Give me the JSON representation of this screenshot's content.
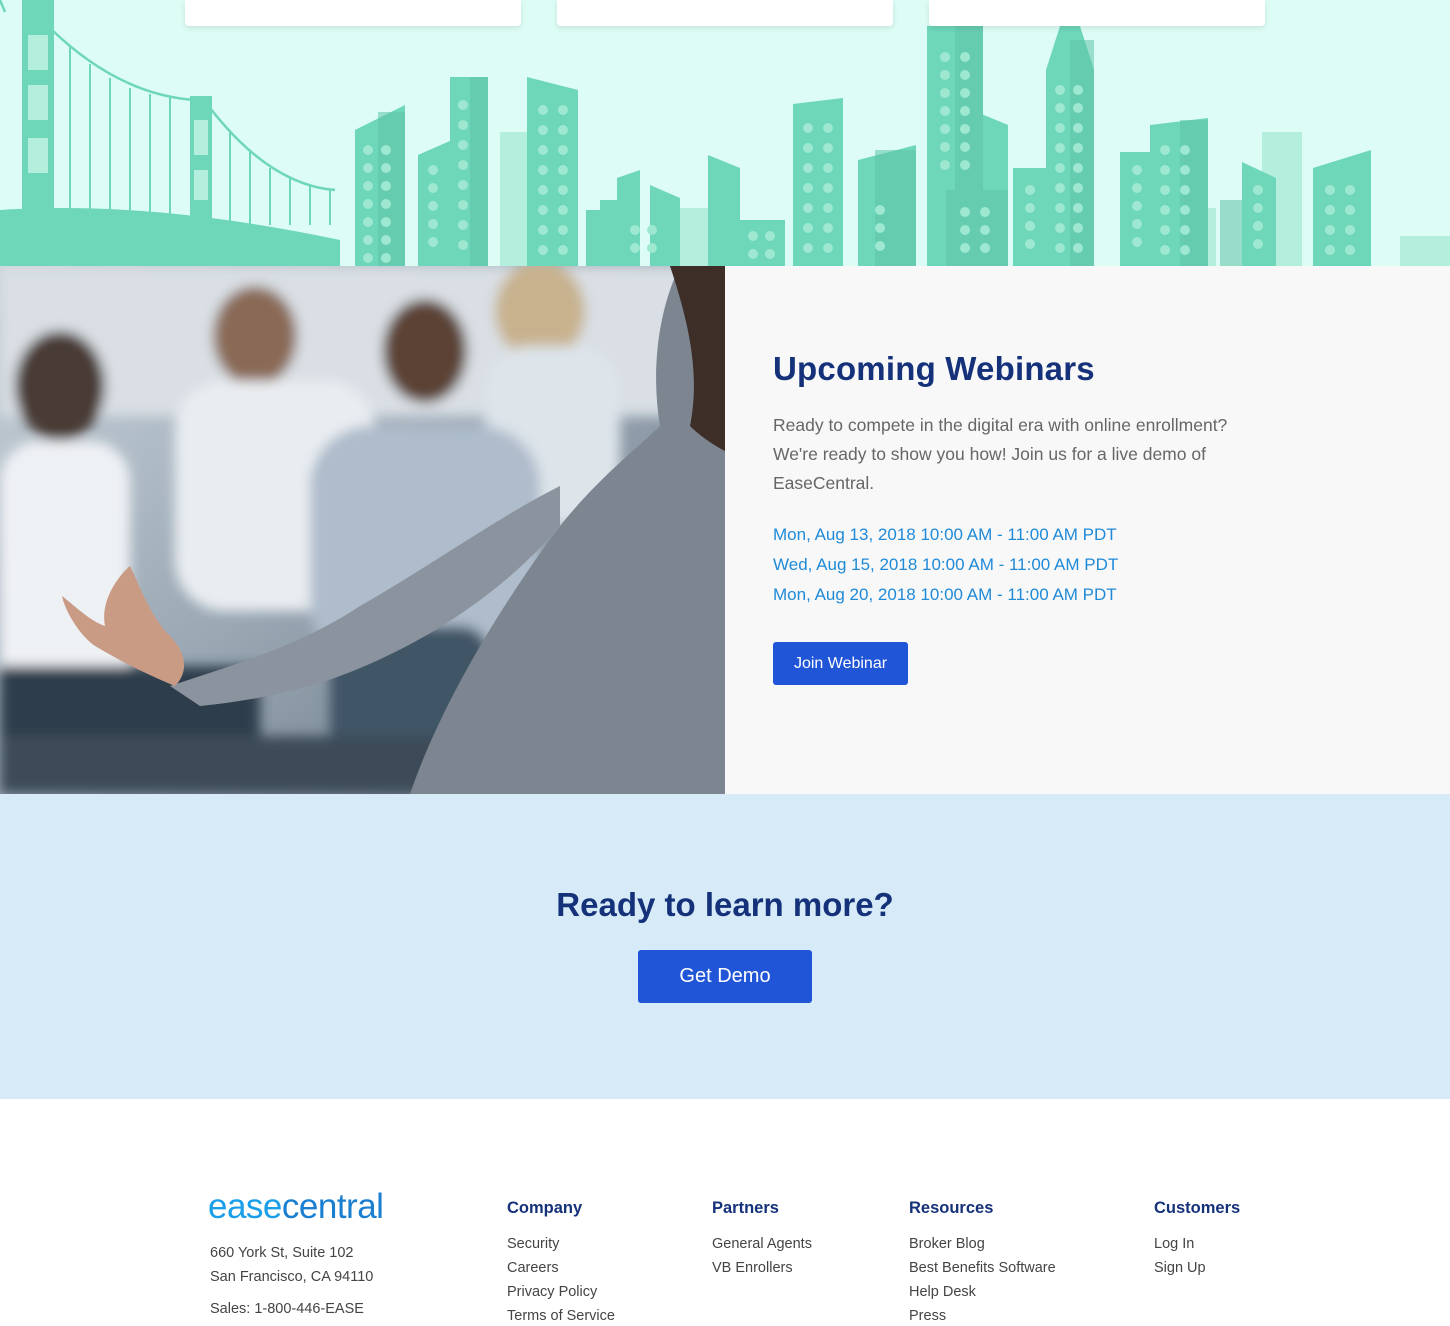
{
  "colors": {
    "navy": "#14317a",
    "link_blue": "#1f8ad8",
    "button_blue": "#1f55d6",
    "mint_bg": "#dcfcf5",
    "building": "#6ed6b9",
    "cta_bg": "#d6ebf7",
    "panel_bg": "#f8f8f8"
  },
  "webinar": {
    "title": "Upcoming Webinars",
    "description": "Ready to compete in the digital era with online enrollment? We're ready to show you how! Join us for a live demo of EaseCentral.",
    "dates": [
      "Mon, Aug 13, 2018 10:00 AM - 11:00 AM PDT",
      "Wed, Aug 15, 2018 10:00 AM - 11:00 AM PDT",
      "Mon, Aug 20, 2018 10:00 AM - 11:00 AM PDT"
    ],
    "button": "Join Webinar"
  },
  "cta": {
    "title": "Ready to learn more?",
    "button": "Get Demo"
  },
  "footer": {
    "logo_left": "ease",
    "logo_right": "central",
    "address_line1": "660 York St, Suite 102",
    "address_line2": "San Francisco, CA 94110",
    "sales": "Sales: 1-800-446-EASE",
    "columns": [
      {
        "heading": "Company",
        "links": [
          "Security",
          "Careers",
          "Privacy Policy",
          "Terms of Service"
        ]
      },
      {
        "heading": "Partners",
        "links": [
          "General Agents",
          "VB Enrollers"
        ]
      },
      {
        "heading": "Resources",
        "links": [
          "Broker Blog",
          "Best Benefits Software",
          "Help Desk",
          "Press"
        ]
      },
      {
        "heading": "Customers",
        "links": [
          "Log In",
          "Sign Up"
        ]
      }
    ]
  }
}
